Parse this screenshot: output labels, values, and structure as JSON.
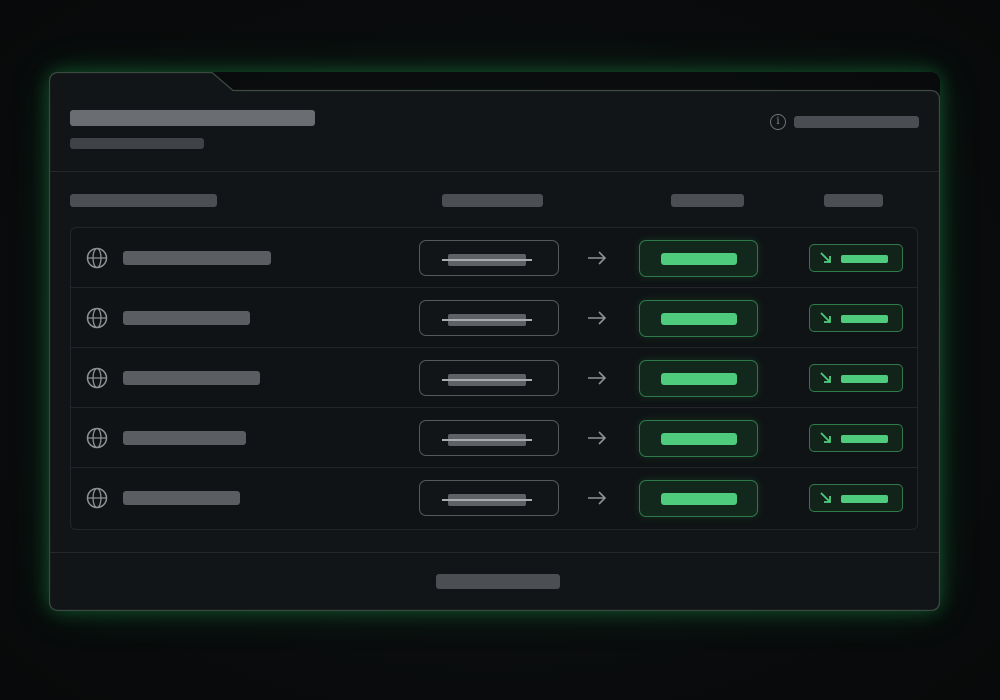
{
  "colors": {
    "accent": "#4ecb7c",
    "accent_border": "#2f7a4a",
    "panel": "#121518",
    "frame_border": "#3c4b42",
    "placeholder": "#5a5d61"
  },
  "header": {
    "info_icon": "info-icon"
  },
  "table": {
    "rows": [
      {
        "icon": "globe-icon",
        "arrow_icon": "arrow-right-icon",
        "trend_icon": "trend-down-icon"
      },
      {
        "icon": "globe-icon",
        "arrow_icon": "arrow-right-icon",
        "trend_icon": "trend-down-icon"
      },
      {
        "icon": "globe-icon",
        "arrow_icon": "arrow-right-icon",
        "trend_icon": "trend-down-icon"
      },
      {
        "icon": "globe-icon",
        "arrow_icon": "arrow-right-icon",
        "trend_icon": "trend-down-icon"
      },
      {
        "icon": "globe-icon",
        "arrow_icon": "arrow-right-icon",
        "trend_icon": "trend-down-icon"
      }
    ]
  }
}
